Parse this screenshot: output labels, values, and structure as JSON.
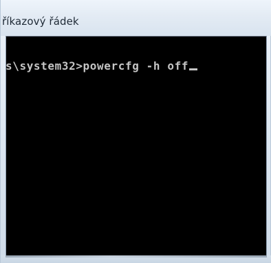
{
  "window": {
    "title": "říkazový řádek"
  },
  "console": {
    "command_line": "s\\system32>powercfg -h off",
    "cursor_visible": true,
    "text_color": "#c4c4c4",
    "background_color": "#000000"
  }
}
